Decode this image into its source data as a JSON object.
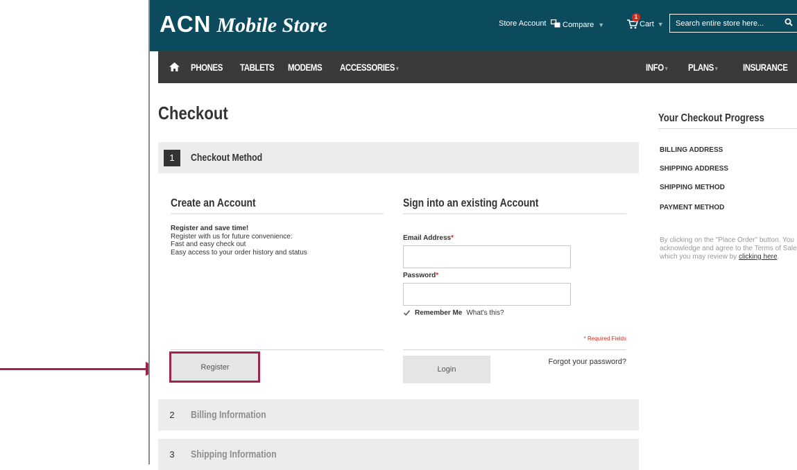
{
  "header": {
    "logo_acn": "ACN",
    "logo_rest": "Mobile Store",
    "store_account": "Store Account",
    "compare": "Compare",
    "cart": "Cart",
    "cart_count": "1",
    "search_placeholder": "Search entire store here..."
  },
  "nav": {
    "left": [
      "PHONES",
      "TABLETS",
      "MODEMS",
      "ACCESSORIES"
    ],
    "right": [
      "INFO",
      "PLANS",
      "INSURANCE"
    ]
  },
  "page": {
    "title": "Checkout"
  },
  "steps": [
    {
      "num": "1",
      "title": "Checkout Method"
    },
    {
      "num": "2",
      "title": "Billing Information"
    },
    {
      "num": "3",
      "title": "Shipping Information"
    }
  ],
  "create_account": {
    "heading": "Create an Account",
    "lead": "Register and save time!",
    "lines": [
      "Register with us for future convenience:",
      "Fast and easy check out",
      "Easy access to your order history and status"
    ],
    "register_button": "Register"
  },
  "sign_in": {
    "heading": "Sign into an existing Account",
    "email_label": "Email Address",
    "password_label": "Password",
    "required_mark": "*",
    "remember_me": "Remember Me",
    "whats_this": "What's this?",
    "required_fields": "* Required Fields",
    "forgot_password": "Forgot your password?",
    "login_button": "Login"
  },
  "progress": {
    "title": "Your Checkout Progress",
    "items": [
      "BILLING ADDRESS",
      "SHIPPING ADDRESS",
      "SHIPPING METHOD",
      "PAYMENT METHOD"
    ],
    "note_before": "By clicking on the \"Place Order\" button. You acknowledge and agree to the Terms of Sale which you may review by ",
    "note_link": "clicking here",
    "note_after": "."
  },
  "colors": {
    "header_bg": "#0c4a5e",
    "nav_bg": "#3a3a3a",
    "callout": "#a3234a",
    "required": "#d52b1e"
  }
}
